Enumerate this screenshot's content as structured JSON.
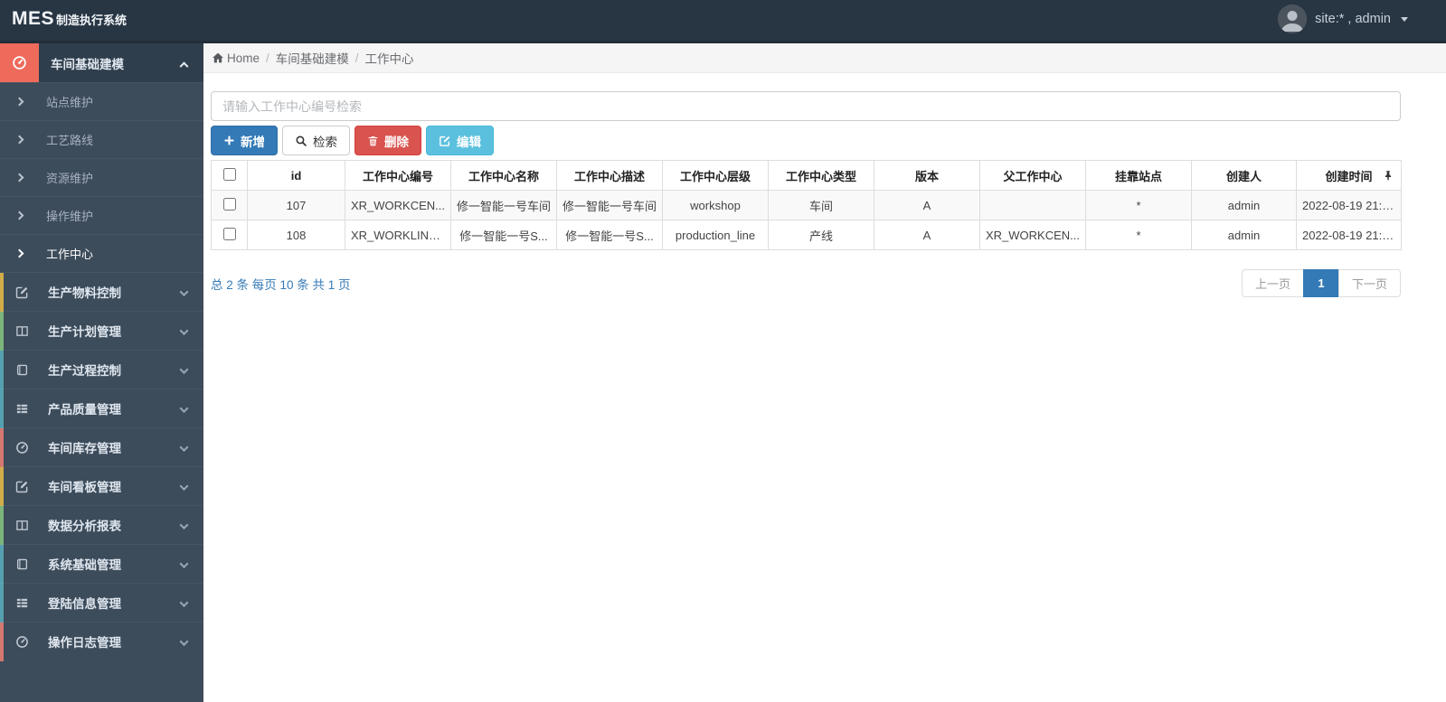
{
  "navbar": {
    "brand_primary": "MES",
    "brand_secondary": "制造执行系统",
    "user_label": "site:* , admin"
  },
  "breadcrumb": {
    "home": "Home",
    "level1": "车间基础建模",
    "current": "工作中心"
  },
  "sidebar": {
    "active_group": {
      "label": "车间基础建模",
      "icon": "gauge-icon"
    },
    "items": [
      {
        "label": "站点维护",
        "active": false
      },
      {
        "label": "工艺路线",
        "active": false
      },
      {
        "label": "资源维护",
        "active": false
      },
      {
        "label": "操作维护",
        "active": false
      },
      {
        "label": "工作中心",
        "active": true
      }
    ],
    "groups": [
      {
        "label": "生产物料控制",
        "icon": "edit-icon",
        "strip": "#d1ac49"
      },
      {
        "label": "生产计划管理",
        "icon": "columns-icon",
        "strip": "#7cb47c"
      },
      {
        "label": "生产过程控制",
        "icon": "book-icon",
        "strip": "#55a0b0"
      },
      {
        "label": "产品质量管理",
        "icon": "list-icon",
        "strip": "#55a0b0"
      },
      {
        "label": "车间库存管理",
        "icon": "gauge-icon",
        "strip": "#d47770"
      },
      {
        "label": "车间看板管理",
        "icon": "edit-icon",
        "strip": "#d1ac49"
      },
      {
        "label": "数据分析报表",
        "icon": "columns-icon",
        "strip": "#7cb47c"
      },
      {
        "label": "系统基础管理",
        "icon": "book-icon",
        "strip": "#55a0b0"
      },
      {
        "label": "登陆信息管理",
        "icon": "list-icon",
        "strip": "#55a0b0"
      },
      {
        "label": "操作日志管理",
        "icon": "gauge-icon",
        "strip": "#d47770"
      }
    ]
  },
  "toolbar": {
    "search_placeholder": "请输入工作中心编号检索",
    "add_label": "新增",
    "search_label": "检索",
    "delete_label": "删除",
    "edit_label": "编辑"
  },
  "table": {
    "columns": [
      "id",
      "工作中心编号",
      "工作中心名称",
      "工作中心描述",
      "工作中心层级",
      "工作中心类型",
      "版本",
      "父工作中心",
      "挂靠站点",
      "创建人",
      "创建时间"
    ],
    "rows": [
      {
        "cells": [
          "107",
          "XR_WORKCEN...",
          "修一智能一号车间",
          "修一智能一号车间",
          "workshop",
          "车间",
          "A",
          "",
          "*",
          "admin",
          "2022-08-19 21:1..."
        ]
      },
      {
        "cells": [
          "108",
          "XR_WORKLINE...",
          "修一智能一号S...",
          "修一智能一号S...",
          "production_line",
          "产线",
          "A",
          "XR_WORKCEN...",
          "*",
          "admin",
          "2022-08-19 21:1..."
        ]
      }
    ]
  },
  "pagination": {
    "summary": "总 2 条  每页 10 条  共 1 页",
    "prev_label": "上一页",
    "current_page": "1",
    "next_label": "下一页"
  },
  "colors": {
    "primary": "#337ab7",
    "danger": "#d9534f",
    "info": "#5bc0de",
    "sidebar_accent": "#ee6a5b",
    "navbar_bg": "#283644",
    "sidebar_bg": "#3d4c5b"
  }
}
